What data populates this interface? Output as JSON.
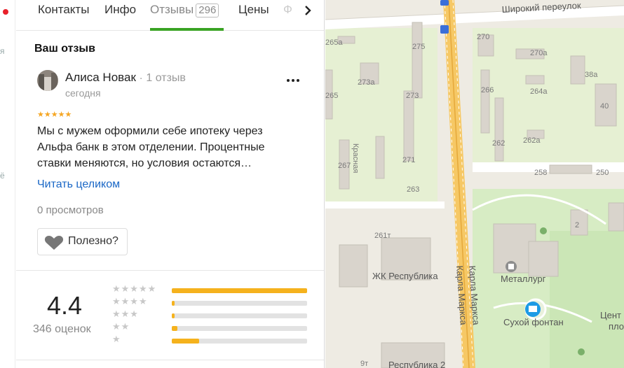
{
  "tabs": [
    {
      "label": "Контакты"
    },
    {
      "label": "Инфо"
    },
    {
      "label": "Отзывы",
      "count": "296"
    },
    {
      "label": "Цены"
    },
    {
      "label": "Ф"
    }
  ],
  "review_section": {
    "title": "Ваш отзыв",
    "author": "Алиса Новак",
    "separator": "·",
    "review_count": "1 отзыв",
    "date": "сегодня",
    "rating": 5,
    "stars": "★★★★★",
    "text": "Мы с мужем оформили себе ипотеку через Альфа банк в этом отделении. Процентные ставки меняются, но условия остаются…",
    "read_more": "Читать целиком",
    "views": "0 просмотров",
    "useful_label": "Полезно?"
  },
  "summary": {
    "average": "4.4",
    "total": "346 оценок",
    "distribution": [
      {
        "stars": "★★★★★",
        "fraction": 1.0
      },
      {
        "stars": "★★★★",
        "fraction": 0.02
      },
      {
        "stars": "★★★",
        "fraction": 0.02
      },
      {
        "stars": "★★",
        "fraction": 0.04
      },
      {
        "stars": "★",
        "fraction": 0.2
      }
    ]
  },
  "map": {
    "street_top": "Широкий переулок",
    "street_main": "Карла Маркса",
    "street_main2": "Карла Маркса",
    "street_side": "Красная",
    "poi_1": "ЖК Республика",
    "poi_2": "Металлург",
    "poi_3": "Сухой фонтан",
    "poi_4": "Цент",
    "poi_4b": "пло",
    "poi_5": "Республика 2",
    "houses": [
      "265а",
      "275",
      "270",
      "270а",
      "273а",
      "38а",
      "265",
      "266",
      "264а",
      "273",
      "40",
      "267",
      "271",
      "262",
      "262а",
      "258",
      "250",
      "263",
      "261т",
      "2",
      "9т"
    ]
  },
  "colors": {
    "accent_green": "#3aa324",
    "link_blue": "#1a67c6",
    "star_gold": "#f5a623",
    "bar_yellow": "#f5b21d",
    "road_orange": "#f6c865"
  }
}
